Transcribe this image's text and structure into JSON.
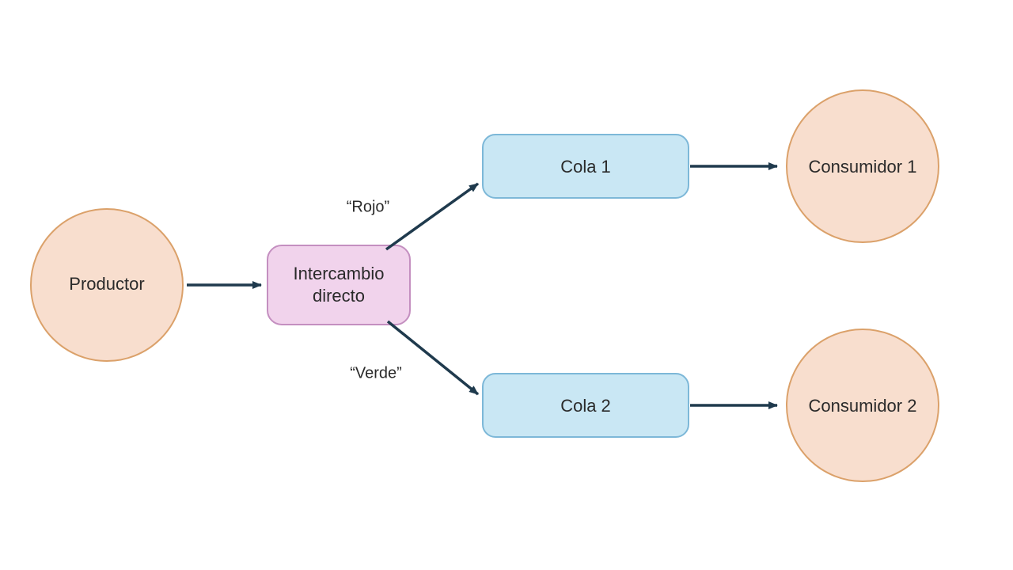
{
  "diagram": {
    "producer": {
      "label": "Productor"
    },
    "exchange": {
      "line1": "Intercambio",
      "line2": "directo"
    },
    "queue1": {
      "label": "Cola 1"
    },
    "queue2": {
      "label": "Cola 2"
    },
    "consumer1": {
      "label": "Consumidor 1"
    },
    "consumer2": {
      "label": "Consumidor 2"
    },
    "routingKey1": "“Rojo”",
    "routingKey2": "“Verde”"
  },
  "colors": {
    "circleFill": "#f8dece",
    "circleStroke": "#dba16a",
    "exchangeFill": "#f1d3ec",
    "exchangeStroke": "#c48fc0",
    "queueFill": "#c9e7f4",
    "queueStroke": "#7db8d8",
    "arrow": "#1f3a4d"
  }
}
